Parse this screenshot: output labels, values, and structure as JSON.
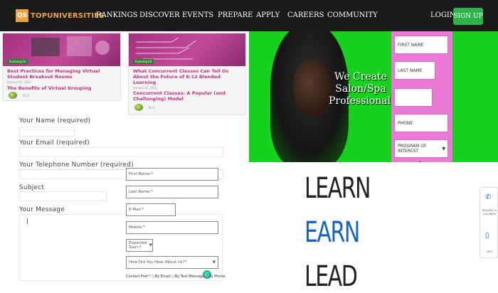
{
  "nav": {
    "logo_mark": "QS",
    "logo_text": "TOPUNIVERSITIES",
    "items": [
      "RANKINGS",
      "DISCOVER",
      "EVENTS",
      "PREPARE",
      "APPLY",
      "CAREERS",
      "COMMUNITY"
    ],
    "login": "LOGIN",
    "signup": "SIGN UP"
  },
  "cards": [
    {
      "tag": "Evolving Ed",
      "title": "Best Practices for Managing Virtual Student Breakout Rooms",
      "date": "January 05, 2021",
      "subtitle": "The Benefits of Virtual Grouping",
      "author": "CL S"
    },
    {
      "tag": "Evolving Ed",
      "title": "What Concurrent Classes Can Tell Us About the Future of K-12 Blended Learning",
      "date": "January 26, 2021",
      "subtitle": "Concurrent Classes: A Popular (and Challenging) Model",
      "author": "PL A"
    }
  ],
  "contact_form": {
    "name_label": "Your Name (required)",
    "email_label": "Your Email (required)",
    "phone_label": "Your Telephone Number (required)",
    "subject_label": "Subject",
    "message_label": "Your Message",
    "grammarly_icon": "G"
  },
  "banner": {
    "tagline": "We Create Salon/Spa Professionals",
    "fields": [
      "FIRST NAME",
      "LAST NAME",
      "",
      "PHONE",
      "PROGRAM OF INTEREST"
    ],
    "select_arrow": "▼"
  },
  "learn": {
    "words": [
      "LEARN",
      "EARN",
      "LEAD"
    ],
    "word_colors": [
      "#222222",
      "#1565c0",
      "#222222"
    ]
  },
  "lead_form": {
    "fields": [
      "First Name:*",
      "Last Name:*",
      "E-Mail:*",
      "Mobile:*",
      "Expected Start:*",
      "How Did You Hear About Us?*"
    ],
    "dropdown_arrow": "▼",
    "contact_label": "Contact Pref:*",
    "options": [
      "By Email",
      "By Text Message",
      "By Phone"
    ]
  },
  "side_widget": {
    "phone_icon": "✆",
    "request_text": "REQUEST A CALLBACK",
    "mobile_icon": "▯",
    "text_label": "TEXT"
  },
  "colors": {
    "nav_bg": "#1b1b1b",
    "brand_orange": "#e8a33c",
    "signup_green": "#2db34a",
    "card_pink": "#c0357f",
    "banner_green": "#16d11d",
    "panel_pink": "#ee7ad8",
    "accent_blue": "#1565c0"
  }
}
